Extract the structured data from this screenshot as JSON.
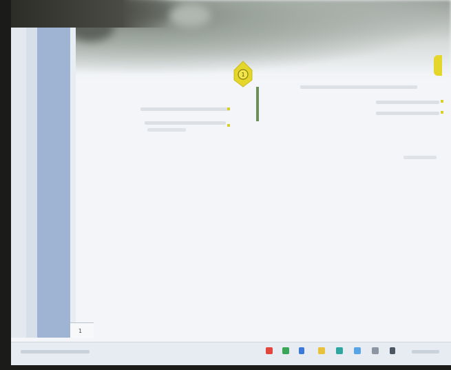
{
  "slide": {
    "pin_number": "1",
    "left_block": {
      "heading": "",
      "bullets": [
        "",
        ""
      ]
    },
    "right_block": {
      "heading": "",
      "bullets": [
        "",
        ""
      ]
    }
  },
  "editor": {
    "slide_number": "1"
  },
  "taskbar": {
    "left_text": "",
    "right_text": "",
    "icons": [
      {
        "name": "app-red-icon",
        "color": "#e2453c"
      },
      {
        "name": "app-green-icon",
        "color": "#3aa657"
      },
      {
        "name": "app-blue-icon",
        "color": "#3b78d8"
      },
      {
        "name": "app-yellow-icon",
        "color": "#e7c33b"
      },
      {
        "name": "app-teal-icon",
        "color": "#2fa7a0"
      },
      {
        "name": "app-lightblue-icon",
        "color": "#56a4e6"
      },
      {
        "name": "app-gray-icon",
        "color": "#8c96a3"
      },
      {
        "name": "app-dark-icon",
        "color": "#4c5663"
      }
    ]
  },
  "colors": {
    "accent_yellow": "#e4d62a",
    "sidebar_blue": "#9fb4d2",
    "taskbar_bg": "#e7ecf2"
  }
}
